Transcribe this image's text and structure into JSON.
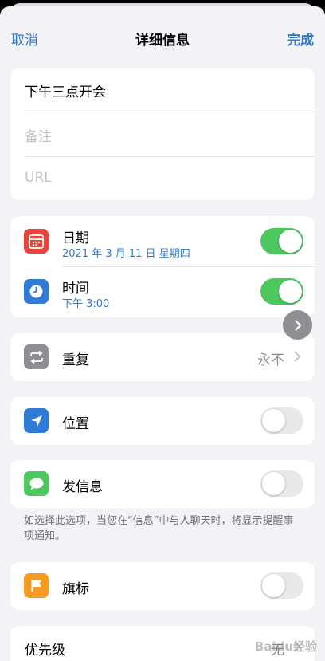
{
  "nav": {
    "cancel": "取消",
    "title": "详细信息",
    "done": "完成"
  },
  "fields": {
    "title": "下午三点开会",
    "notes_placeholder": "备注",
    "url_placeholder": "URL"
  },
  "date_row": {
    "label": "日期",
    "value": "2021 年 3 月 11 日 星期四",
    "enabled": true
  },
  "time_row": {
    "label": "时间",
    "value": "下午 3:00",
    "enabled": true
  },
  "repeat_row": {
    "label": "重复",
    "value": "永不"
  },
  "location_row": {
    "label": "位置",
    "enabled": false
  },
  "message_row": {
    "label": "发信息",
    "enabled": false
  },
  "message_footnote": "如选择此选项，当您在“信息”中与人聊天时，将显示提醒事项通知。",
  "flag_row": {
    "label": "旗标",
    "enabled": false
  },
  "priority_row": {
    "label": "优先级",
    "value": "无"
  },
  "watermark": "Baidu经验",
  "colors": {
    "accent": "#3478c8",
    "toggle_on": "#4dc85f",
    "date_icon": "#e8463c",
    "time_icon": "#2f7bd6",
    "repeat_icon": "#8e8e93",
    "location_icon": "#2f7bd6",
    "message_icon": "#4dc85f",
    "flag_icon": "#f59a23"
  },
  "icons": {
    "date": "calendar-icon",
    "time": "clock-icon",
    "repeat": "repeat-icon",
    "location": "location-arrow-icon",
    "message": "message-bubble-icon",
    "flag": "flag-icon",
    "chevron": "chevron-right-icon",
    "float": "chevron-right-icon"
  }
}
